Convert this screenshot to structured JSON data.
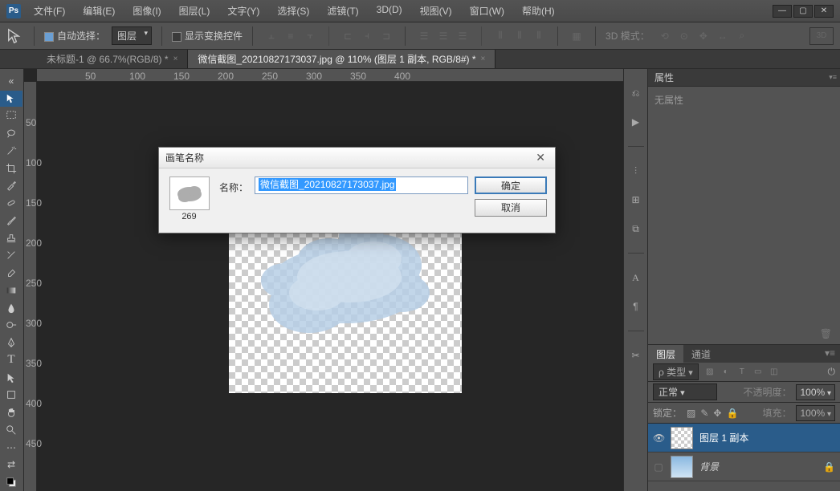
{
  "app": {
    "logo": "Ps"
  },
  "menu": {
    "file": "文件(F)",
    "edit": "编辑(E)",
    "image": "图像(I)",
    "layer": "图层(L)",
    "text": "文字(Y)",
    "select": "选择(S)",
    "filter": "滤镜(T)",
    "threed": "3D(D)",
    "view": "视图(V)",
    "window": "窗口(W)",
    "help": "帮助(H)"
  },
  "options": {
    "auto_select": "自动选择：",
    "scope": "图层",
    "show_transform": "显示变换控件",
    "mode3d_label": "3D 模式：",
    "threed_btn": "3D"
  },
  "tabs": {
    "t0": {
      "label": "未标题-1 @ 66.7%(RGB/8) *"
    },
    "t1": {
      "label": "微信截图_20210827173037.jpg @ 110% (图层 1 副本, RGB/8#) *"
    }
  },
  "ruler": {
    "h": [
      "50",
      "100",
      "150",
      "200",
      "250",
      "300",
      "350",
      "400"
    ],
    "v": [
      "50",
      "100",
      "150",
      "200",
      "250",
      "300",
      "350",
      "400",
      "450"
    ]
  },
  "properties": {
    "tab": "属性",
    "none": "无属性"
  },
  "layers": {
    "tab_layers": "图层",
    "tab_channels": "通道",
    "kind_label": "ρ 类型",
    "mode": "正常",
    "opacity_label": "不透明度：",
    "opacity": "100%",
    "lock_label": "锁定：",
    "fill_label": "填充：",
    "fill": "100%",
    "row1": "图层 1 副本",
    "row2": "背景"
  },
  "dialog": {
    "title": "画笔名称",
    "preset_size": "269",
    "name_label": "名称：",
    "name_value": "微信截图_20210827173037.jpg",
    "ok": "确定",
    "cancel": "取消"
  }
}
